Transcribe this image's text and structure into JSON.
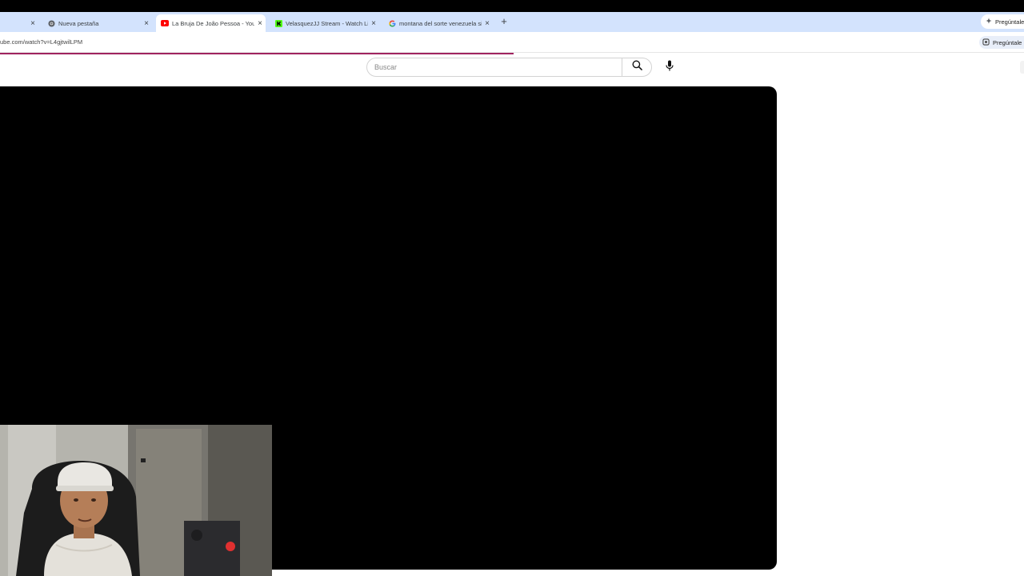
{
  "browser": {
    "tabs": [
      {
        "label": "",
        "favicon": "none",
        "active": false
      },
      {
        "label": "Nueva pestaña",
        "favicon": "chrome-icon",
        "active": false
      },
      {
        "label": "La Bruja De João Pessoa - YouT",
        "favicon": "youtube-icon",
        "active": true
      },
      {
        "label": "VelasquezJJ Stream - Watch Liv",
        "favicon": "kick-icon",
        "active": false
      },
      {
        "label": "montana del sorte venezuela si",
        "favicon": "google-icon",
        "active": false
      }
    ],
    "new_tab_symbol": "+",
    "close_symbol": "×",
    "ask_tab_label": "Pregúntale",
    "url": "ube.com/watch?v=L4gjtwilLPM",
    "ask_button_label": "Pregúntale"
  },
  "youtube": {
    "search_placeholder": "Buscar",
    "search_icon": "search-icon",
    "mic_icon": "mic-icon"
  },
  "colors": {
    "tabbar": "#d3e3fd",
    "progress": "#a0245f",
    "youtube_red": "#ff0000",
    "kick_green": "#53fc18"
  }
}
